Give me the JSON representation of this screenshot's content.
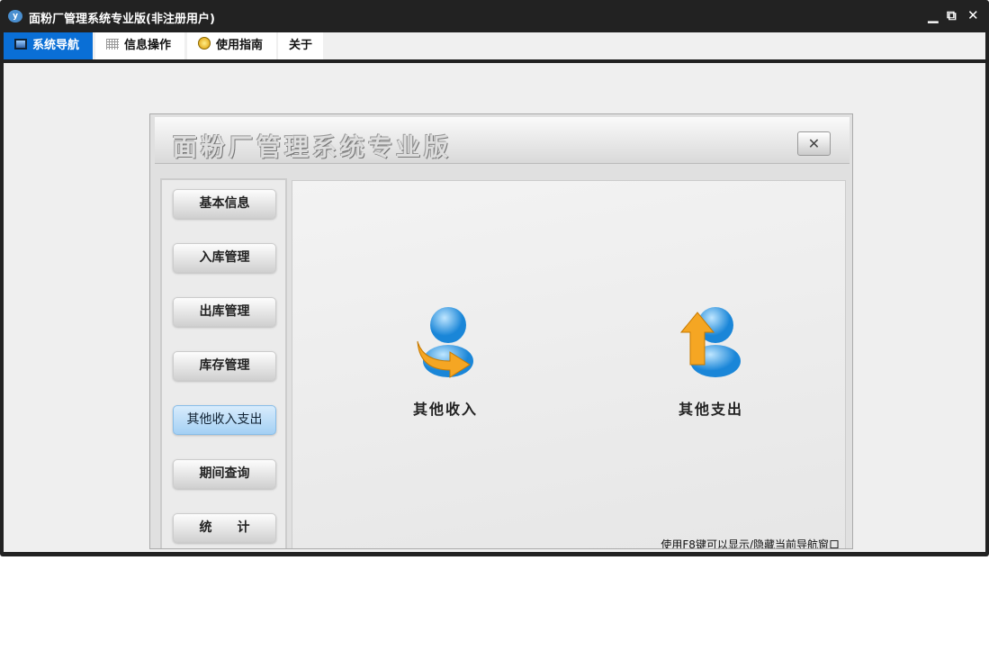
{
  "window": {
    "title": "面粉厂管理系统专业版(非注册用户)",
    "controls": {
      "minimize": "▁",
      "restore": "⧉",
      "close": "✕"
    }
  },
  "tabs": [
    {
      "label": "系统导航",
      "icon": "monitor-icon"
    },
    {
      "label": "信息操作",
      "icon": "grid-icon"
    },
    {
      "label": "使用指南",
      "icon": "help-icon"
    },
    {
      "label": "关于"
    }
  ],
  "panel": {
    "title": "面粉厂管理系统专业版",
    "close": "✕"
  },
  "sidebar": {
    "items": [
      "基本信息",
      "入库管理",
      "出库管理",
      "库存管理",
      "其他收入支出",
      "期间查询",
      "统　　计"
    ],
    "active": 4
  },
  "main": {
    "actions": [
      {
        "label": "其他收入",
        "icon": "user-income-icon"
      },
      {
        "label": "其他支出",
        "icon": "user-expense-icon"
      }
    ],
    "hint": "使用F8键可以显示/隐藏当前导航窗口"
  },
  "colors": {
    "accent": "#0a6fd6",
    "frame": "#222222"
  }
}
